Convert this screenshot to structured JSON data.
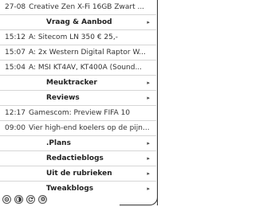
{
  "items": [
    {
      "kind": "news",
      "time": "27-08",
      "title": "Creative Zen X-Fi 16GB Zwart ..."
    },
    {
      "kind": "section",
      "label": "Vraag & Aanbod",
      "arrow": "▸"
    },
    {
      "kind": "news",
      "time": "15:12",
      "title": "A: Sitecom LN 350 € 25,-"
    },
    {
      "kind": "news",
      "time": "15:07",
      "title": "A: 2x Western Digital Raptor W..."
    },
    {
      "kind": "news",
      "time": "15:04",
      "title": "A: MSI KT4AV, KT400A (Sound..."
    },
    {
      "kind": "section",
      "label": "Meuktracker",
      "arrow": "▸"
    },
    {
      "kind": "section",
      "label": "Reviews",
      "arrow": "▸"
    },
    {
      "kind": "news",
      "time": "12:17",
      "title": "Gamescom: Preview FIFA 10"
    },
    {
      "kind": "news",
      "time": "09:00",
      "title": "Vier high-end koelers op de pijn..."
    },
    {
      "kind": "section",
      "label": ".Plans",
      "arrow": "▸"
    },
    {
      "kind": "section",
      "label": "Redactieblogs",
      "arrow": "▸"
    },
    {
      "kind": "section",
      "label": "Uit de rubrieken",
      "arrow": "▸"
    },
    {
      "kind": "section",
      "label": "Tweakblogs",
      "arrow": "▸"
    }
  ],
  "toolbar": {
    "icons": [
      "settings-icon",
      "contrast-icon",
      "refresh-icon",
      "gear-icon"
    ]
  }
}
